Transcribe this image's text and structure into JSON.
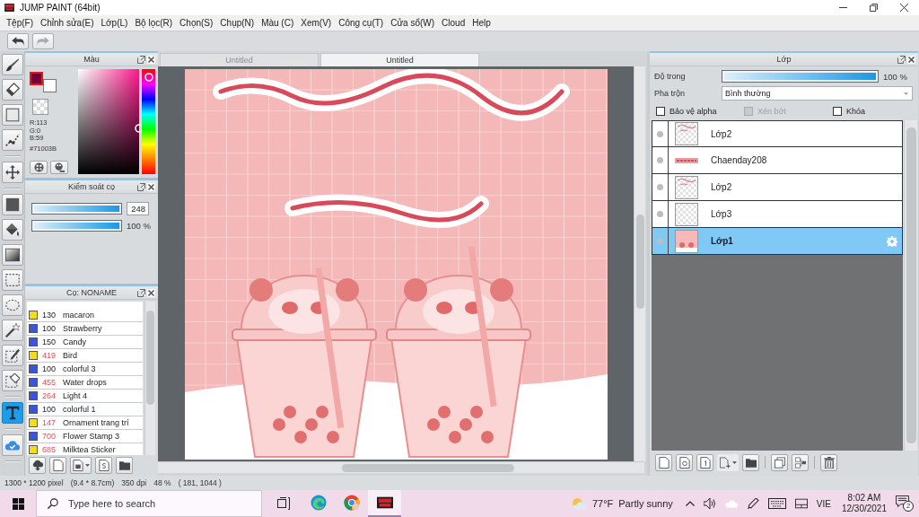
{
  "window": {
    "title": "JUMP PAINT (64bit)"
  },
  "menu": [
    "Tệp(F)",
    "Chỉnh sửa(E)",
    "Lớp(L)",
    "Bộ lọc(R)",
    "Chọn(S)",
    "Chụp(N)",
    "Màu (C)",
    "Xem(V)",
    "Công cụ(T)",
    "Cửa sổ(W)",
    "Cloud",
    "Help"
  ],
  "toolbar": [
    {
      "kind": "undo",
      "disabled": false
    },
    {
      "kind": "redo",
      "disabled": true
    }
  ],
  "tool_groups": [
    {
      "tools": [
        {
          "kind": "brush",
          "selected": false
        },
        {
          "kind": "eraser",
          "selected": false
        },
        {
          "kind": "shape",
          "selected": false
        },
        {
          "kind": "polyline",
          "selected": false
        }
      ]
    },
    {
      "tools": [
        {
          "kind": "move",
          "selected": false
        }
      ]
    },
    {
      "tools": [
        {
          "kind": "fill",
          "selected": false
        },
        {
          "kind": "bucket",
          "selected": false
        },
        {
          "kind": "gradient",
          "selected": false
        },
        {
          "kind": "rect_select",
          "selected": false
        },
        {
          "kind": "lasso",
          "selected": false
        },
        {
          "kind": "wand",
          "selected": false
        },
        {
          "kind": "select_pen",
          "selected": false
        },
        {
          "kind": "select_eraser",
          "selected": false
        }
      ]
    },
    {
      "tools": [
        {
          "kind": "text",
          "selected": true
        }
      ]
    },
    {
      "tools": [
        {
          "kind": "cloud",
          "selected": false
        }
      ]
    }
  ],
  "color_panel": {
    "title": "Màu",
    "swatches": [
      {
        "color": "#71003b",
        "selected": true
      },
      {
        "color": "#ffffff",
        "selected": false
      }
    ],
    "readout": [
      "R:113",
      "G:0",
      "B:59",
      "#71003B"
    ],
    "hue_slider": {
      "level": 0.92
    }
  },
  "brush_control": {
    "title": "Kiểm soát cọ",
    "size": {
      "level": 1,
      "value": "248"
    },
    "opacity": {
      "level": 1,
      "reading": "100 %"
    }
  },
  "brush_panel": {
    "title": "Cọ: NONAME",
    "items": [
      {
        "color": "#f2dc1c",
        "count": "130",
        "name": "macaron",
        "highlighted": false
      },
      {
        "color": "#3a55dc",
        "count": "100",
        "name": "Strawberry",
        "highlighted": false
      },
      {
        "color": "#3a55dc",
        "count": "150",
        "name": "Candy",
        "highlighted": false
      },
      {
        "color": "#f2dc1c",
        "count": "419",
        "name": "Bird",
        "highlighted": true
      },
      {
        "color": "#3a55dc",
        "count": "100",
        "name": "colorful 3",
        "highlighted": false
      },
      {
        "color": "#3a55dc",
        "count": "455",
        "name": "Water drops",
        "highlighted": true
      },
      {
        "color": "#3a55dc",
        "count": "264",
        "name": "Light 4",
        "highlighted": true
      },
      {
        "color": "#3a55dc",
        "count": "100",
        "name": "colorful 1",
        "highlighted": false
      },
      {
        "color": "#f2dc1c",
        "count": "147",
        "name": "Ornament trang trí",
        "highlighted": true
      },
      {
        "color": "#3a55dc",
        "count": "700",
        "name": "Flower Stamp 3",
        "highlighted": true
      },
      {
        "color": "#f2dc1c",
        "count": "685",
        "name": "Milktea Sticker",
        "highlighted": true
      }
    ]
  },
  "canvas": {
    "tabs": [
      {
        "label": "Untitled",
        "selected": false
      },
      {
        "label": "Untitled",
        "selected": true
      }
    ]
  },
  "layer_panel": {
    "title": "Lớp",
    "opacity": {
      "label": "Độ trong",
      "level": 1,
      "reading": "100 %"
    },
    "blend": {
      "label": "Pha trộn",
      "value": "Bình thường"
    },
    "options": [
      {
        "label": "Bảo vệ alpha",
        "checked": false,
        "disabled": false
      },
      {
        "label": "Xén bớt",
        "checked": false,
        "disabled": true
      },
      {
        "label": "Khóa",
        "checked": false,
        "disabled": false
      }
    ],
    "layers": [
      {
        "name": "Lớp2",
        "kind": "sketch",
        "selected": false
      },
      {
        "name": "Chaenday208",
        "kind": "banner",
        "selected": false
      },
      {
        "name": "Lớp2",
        "kind": "sketch",
        "selected": false
      },
      {
        "name": "Lớp3",
        "kind": "empty",
        "selected": false
      },
      {
        "name": "Lớp1",
        "kind": "fill",
        "selected": true
      }
    ]
  },
  "status_bar": [
    "1300 * 1200 pixel",
    "(9.4 * 8.7cm)",
    "350 dpi",
    "48 %",
    "( 181, 1044 )"
  ],
  "taskbar": {
    "search": {
      "placeholder": "Type here to search"
    },
    "apps": [
      {
        "kind": "edge",
        "selected": false
      },
      {
        "kind": "chrome",
        "selected": false
      },
      {
        "kind": "paint",
        "selected": true
      }
    ],
    "temperature": "77°F",
    "condition": "Partly sunny",
    "language": "VIE",
    "time": "8:02 AM",
    "date": "12/30/2021",
    "notifications": "2"
  }
}
